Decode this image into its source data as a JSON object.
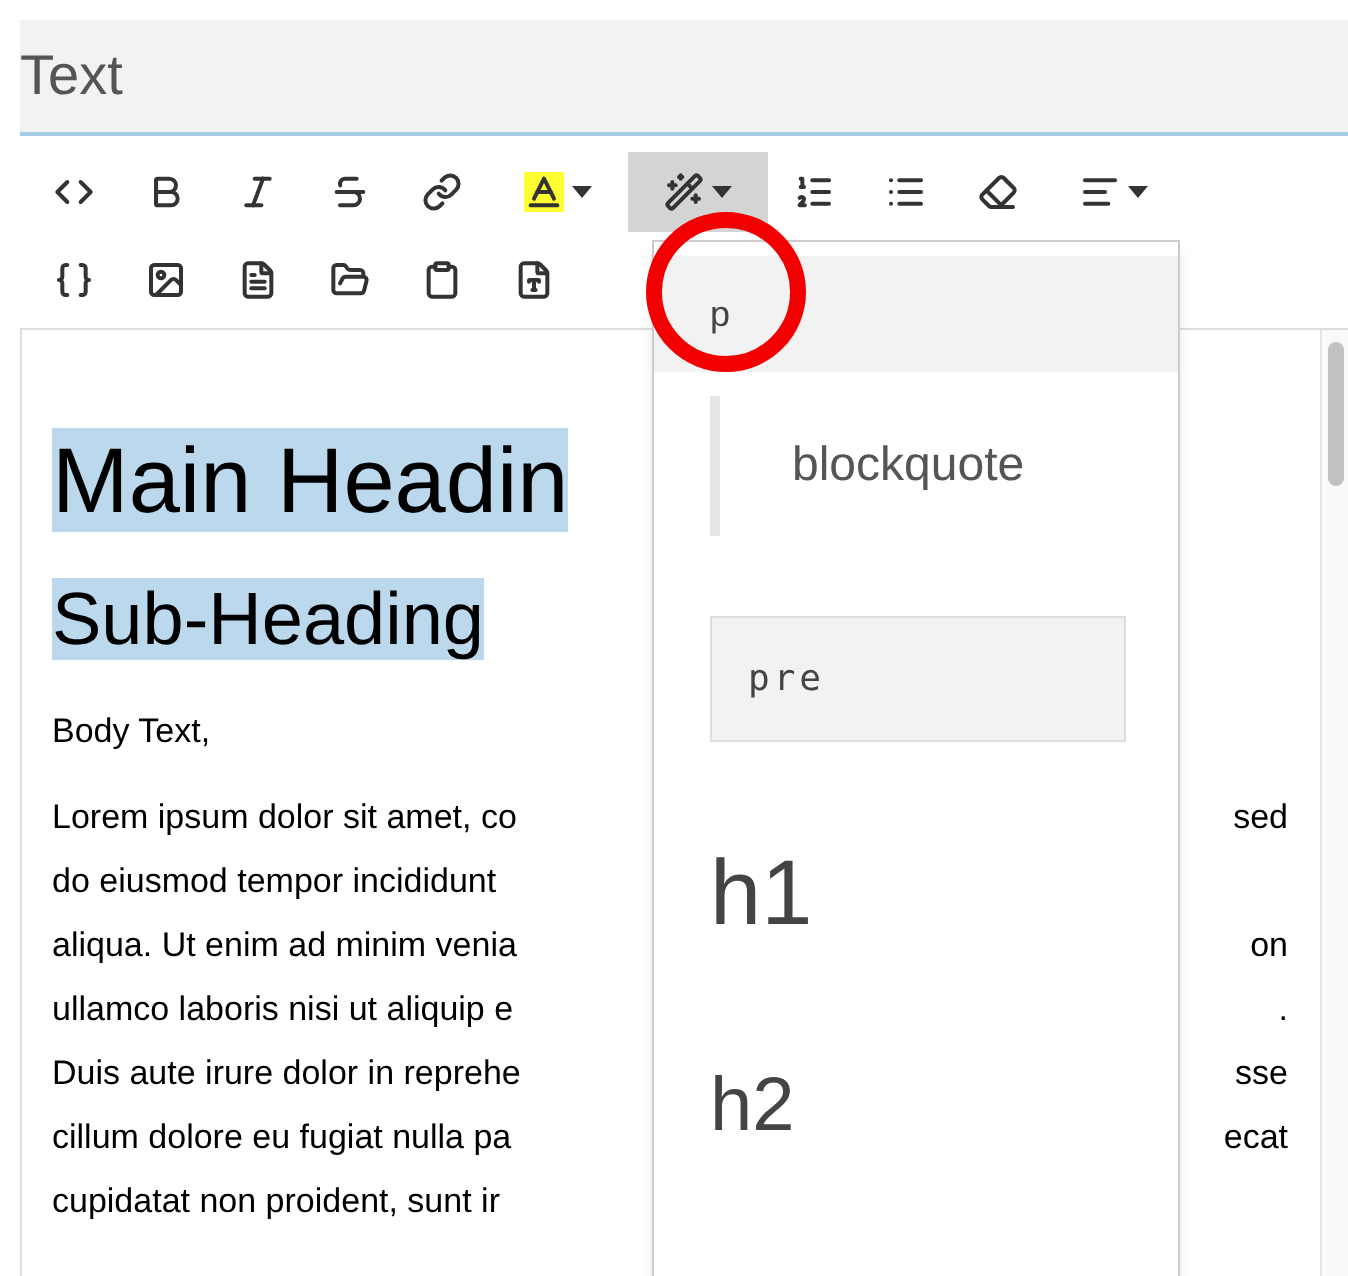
{
  "panel": {
    "title": "Text"
  },
  "toolbar": [
    [
      {
        "kind": "code",
        "selected": false,
        "caret": false
      },
      {
        "kind": "bold",
        "selected": false,
        "caret": false
      },
      {
        "kind": "italic",
        "selected": false,
        "caret": false
      },
      {
        "kind": "strike",
        "selected": false,
        "caret": false
      },
      {
        "kind": "link",
        "selected": false,
        "caret": false
      },
      {
        "kind": "highlight",
        "selected": false,
        "caret": true
      },
      {
        "kind": "style",
        "selected": true,
        "caret": true
      },
      {
        "kind": "ordered",
        "selected": false,
        "caret": false
      },
      {
        "kind": "bullets",
        "selected": false,
        "caret": false
      },
      {
        "kind": "eraser",
        "selected": false,
        "caret": false
      },
      {
        "kind": "align",
        "selected": false,
        "caret": true
      }
    ],
    [
      {
        "kind": "braces",
        "selected": false,
        "caret": false
      },
      {
        "kind": "image",
        "selected": false,
        "caret": false
      },
      {
        "kind": "file",
        "selected": false,
        "caret": false
      },
      {
        "kind": "folder",
        "selected": false,
        "caret": false
      },
      {
        "kind": "clipboard",
        "selected": false,
        "caret": false
      },
      {
        "kind": "word",
        "selected": false,
        "caret": false
      }
    ]
  ],
  "editor": {
    "heading": "Main Headin",
    "subheading": "Sub-Heading",
    "intro": "Body Text,",
    "lines": [
      {
        "left": "Lorem ipsum dolor sit amet, co",
        "right": "sed"
      },
      {
        "left": "do eiusmod tempor incididunt"
      },
      {
        "left": "aliqua. Ut enim ad minim venia",
        "right": "on"
      },
      {
        "left": "ullamco laboris nisi ut aliquip e",
        "right": "."
      },
      {
        "left": "Duis aute irure dolor in reprehe",
        "right": "sse"
      },
      {
        "left": "cillum dolore eu fugiat nulla pa",
        "right": "ecat"
      },
      {
        "left": "cupidatat non proident, sunt ir"
      }
    ]
  },
  "dropdown": [
    {
      "kind": "p",
      "label": "p",
      "selected": true
    },
    {
      "kind": "blockquote",
      "label": "blockquote",
      "selected": false
    },
    {
      "kind": "pre",
      "label": "pre",
      "selected": false
    },
    {
      "kind": "h1",
      "label": "h1",
      "selected": false
    },
    {
      "kind": "h2",
      "label": "h2",
      "selected": false
    }
  ]
}
